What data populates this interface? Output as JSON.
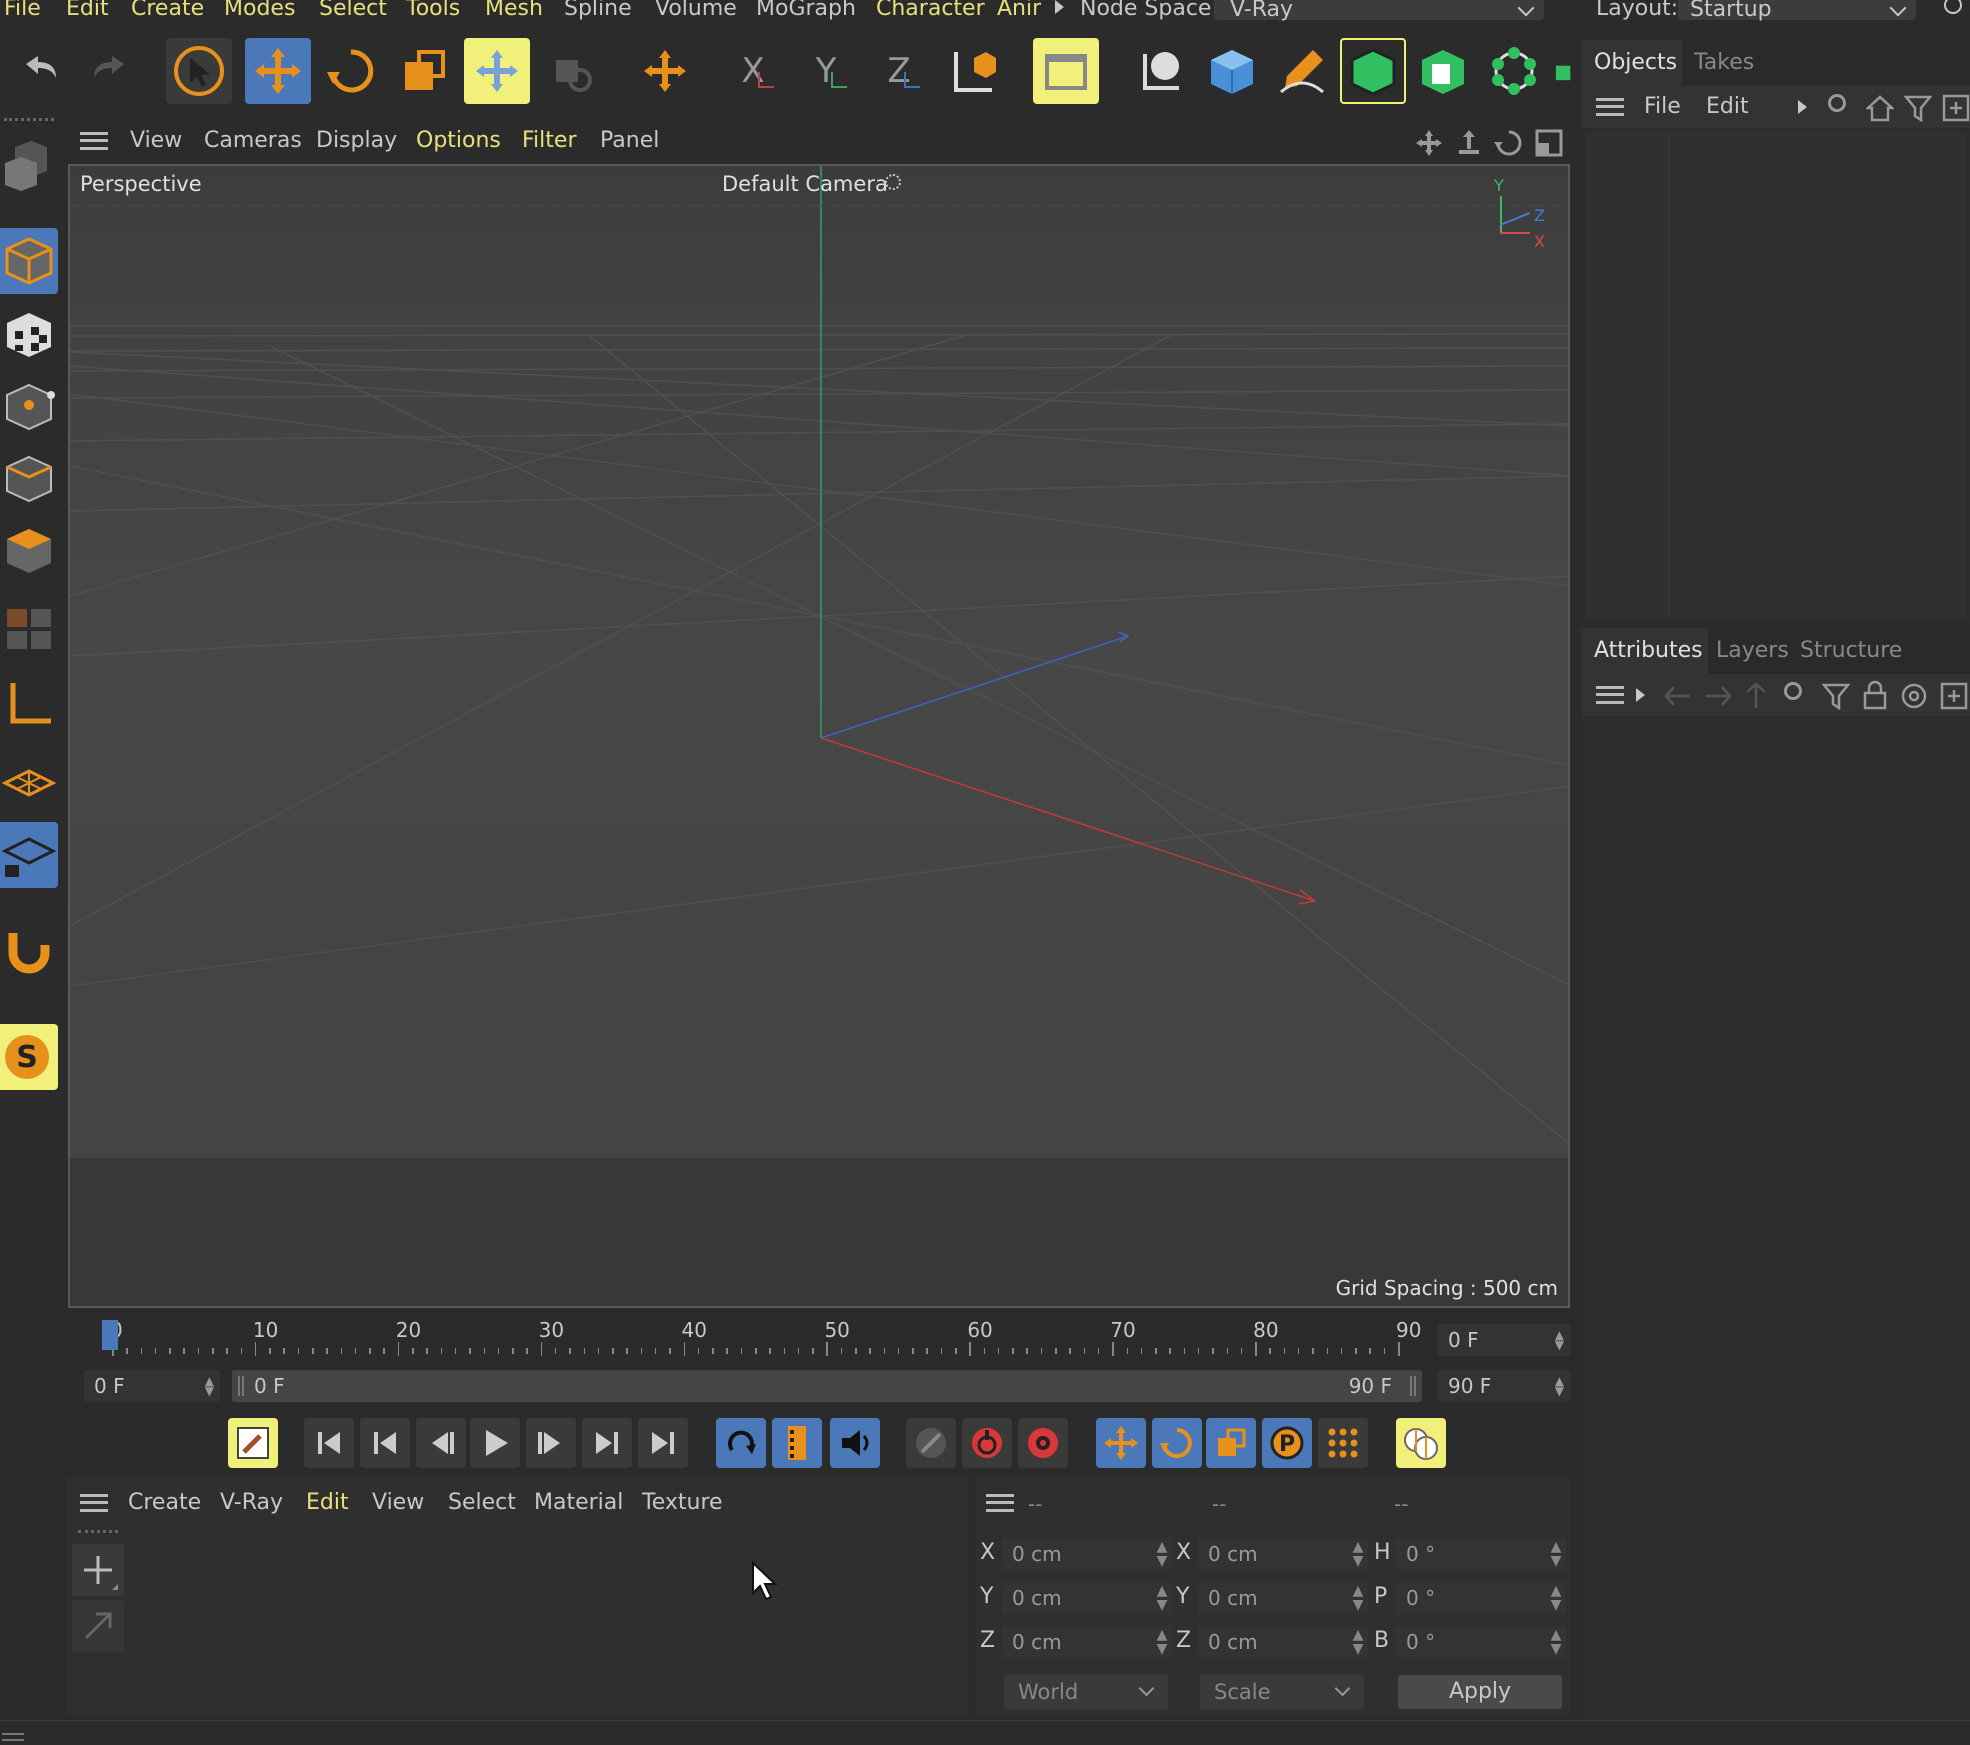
{
  "menubar": {
    "items": [
      "File",
      "Edit",
      "Create",
      "Modes",
      "Select",
      "Tools",
      "Mesh",
      "Spline",
      "Volume",
      "MoGraph",
      "Character",
      "Anim"
    ],
    "node_space_label": "Node Space:",
    "node_space_value": "V-Ray",
    "layout_label": "Layout:",
    "layout_value": "Startup"
  },
  "toolbar": {
    "axis_x": "X",
    "axis_y": "Y",
    "axis_z": "Z"
  },
  "viewport": {
    "menu": [
      "View",
      "Cameras",
      "Display",
      "Options",
      "Filter",
      "Panel"
    ],
    "view_name": "Perspective",
    "camera_name": "Default Camera",
    "grid_spacing": "Grid Spacing : 500 cm",
    "gizmo": {
      "y": "Y",
      "z": "Z",
      "x": "X"
    }
  },
  "objects_panel": {
    "tabs": [
      "Objects",
      "Takes"
    ],
    "menu": [
      "File",
      "Edit"
    ]
  },
  "attributes_panel": {
    "tabs": [
      "Attributes",
      "Layers",
      "Structure"
    ]
  },
  "timeline": {
    "ticks": [
      "0",
      "10",
      "20",
      "30",
      "40",
      "50",
      "60",
      "70",
      "80",
      "90"
    ],
    "current_frame": "0 F",
    "start_field": "0 F",
    "range_start": "0 F",
    "range_end": "90 F",
    "end_field": "90 F",
    "playhead_frame": 0,
    "max_frame": 90
  },
  "material_manager": {
    "menu": [
      "Create",
      "V-Ray",
      "Edit",
      "View",
      "Select",
      "Material",
      "Texture"
    ]
  },
  "coordinates": {
    "headers": [
      "--",
      "--",
      "--"
    ],
    "rows": [
      {
        "l1": "X",
        "v1": "0 cm",
        "l2": "X",
        "v2": "0 cm",
        "l3": "H",
        "v3": "0 °"
      },
      {
        "l1": "Y",
        "v1": "0 cm",
        "l2": "Y",
        "v2": "0 cm",
        "l3": "P",
        "v3": "0 °"
      },
      {
        "l1": "Z",
        "v1": "0 cm",
        "l2": "Z",
        "v2": "0 cm",
        "l3": "B",
        "v3": "0 °"
      }
    ],
    "space": "World",
    "mode": "Scale",
    "apply": "Apply"
  },
  "colors": {
    "accent_yellow": "#f0f07a",
    "active_blue": "#4a78b8",
    "orange": "#e8901c",
    "menu_highlight": "#e8e07a"
  }
}
